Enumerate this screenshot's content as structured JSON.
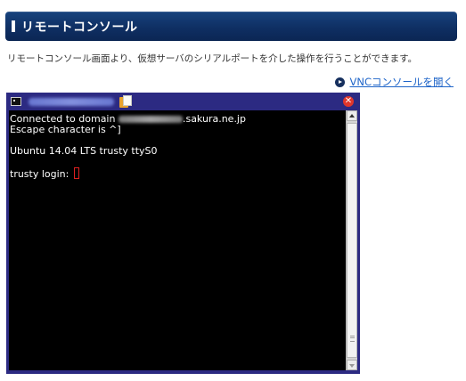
{
  "section": {
    "title": "リモートコンソール"
  },
  "description": "リモートコンソール画面より、仮想サーバのシリアルポートを介した操作を行うことができます。",
  "vnc_link": {
    "label": "VNCコンソールを開く",
    "icon": "circle-arrow-icon"
  },
  "console": {
    "titlebar": {
      "terminal_icon": "terminal-icon",
      "clipboard_icon": "clipboard-icon",
      "close_icon": "close-icon",
      "close_glyph": "✕"
    },
    "lines": {
      "connected_prefix": "Connected to domain ",
      "connected_suffix": ".sakura.ne.jp",
      "escape": "Escape character is ^]",
      "ubuntu": "Ubuntu 14.04 LTS trusty ttyS0",
      "login": "trusty login: "
    }
  },
  "colors": {
    "header_bg": "#0f2f63",
    "console_frame": "#2c2a82",
    "link": "#1e64c8",
    "close": "#e0362b",
    "cursor": "#e02020"
  }
}
